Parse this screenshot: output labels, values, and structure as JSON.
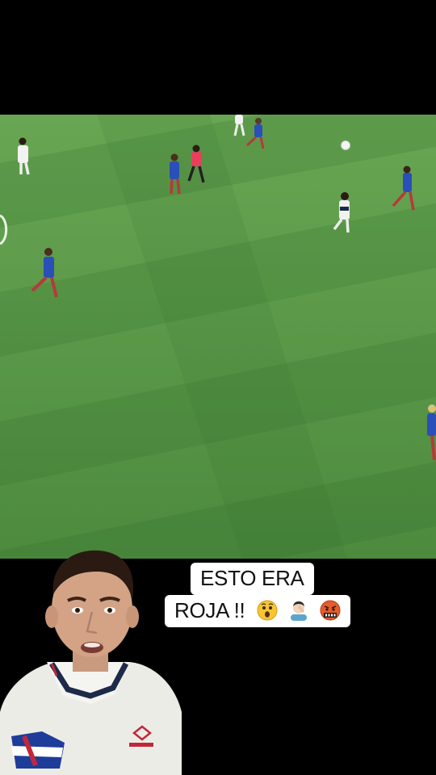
{
  "caption": {
    "line1": "ESTO ERA",
    "line2": "ROJA !!"
  },
  "emojis": [
    "astonished-face-emoji",
    "facepalm-emoji",
    "cursing-face-emoji"
  ],
  "colors": {
    "pitch_light": "#5fa04f",
    "pitch_dark": "#4a8c3f",
    "team_blue": "#2a4fb8",
    "team_white": "#f2f2f2",
    "referee_pink": "#e8405a",
    "caption_bg": "#ffffff"
  }
}
